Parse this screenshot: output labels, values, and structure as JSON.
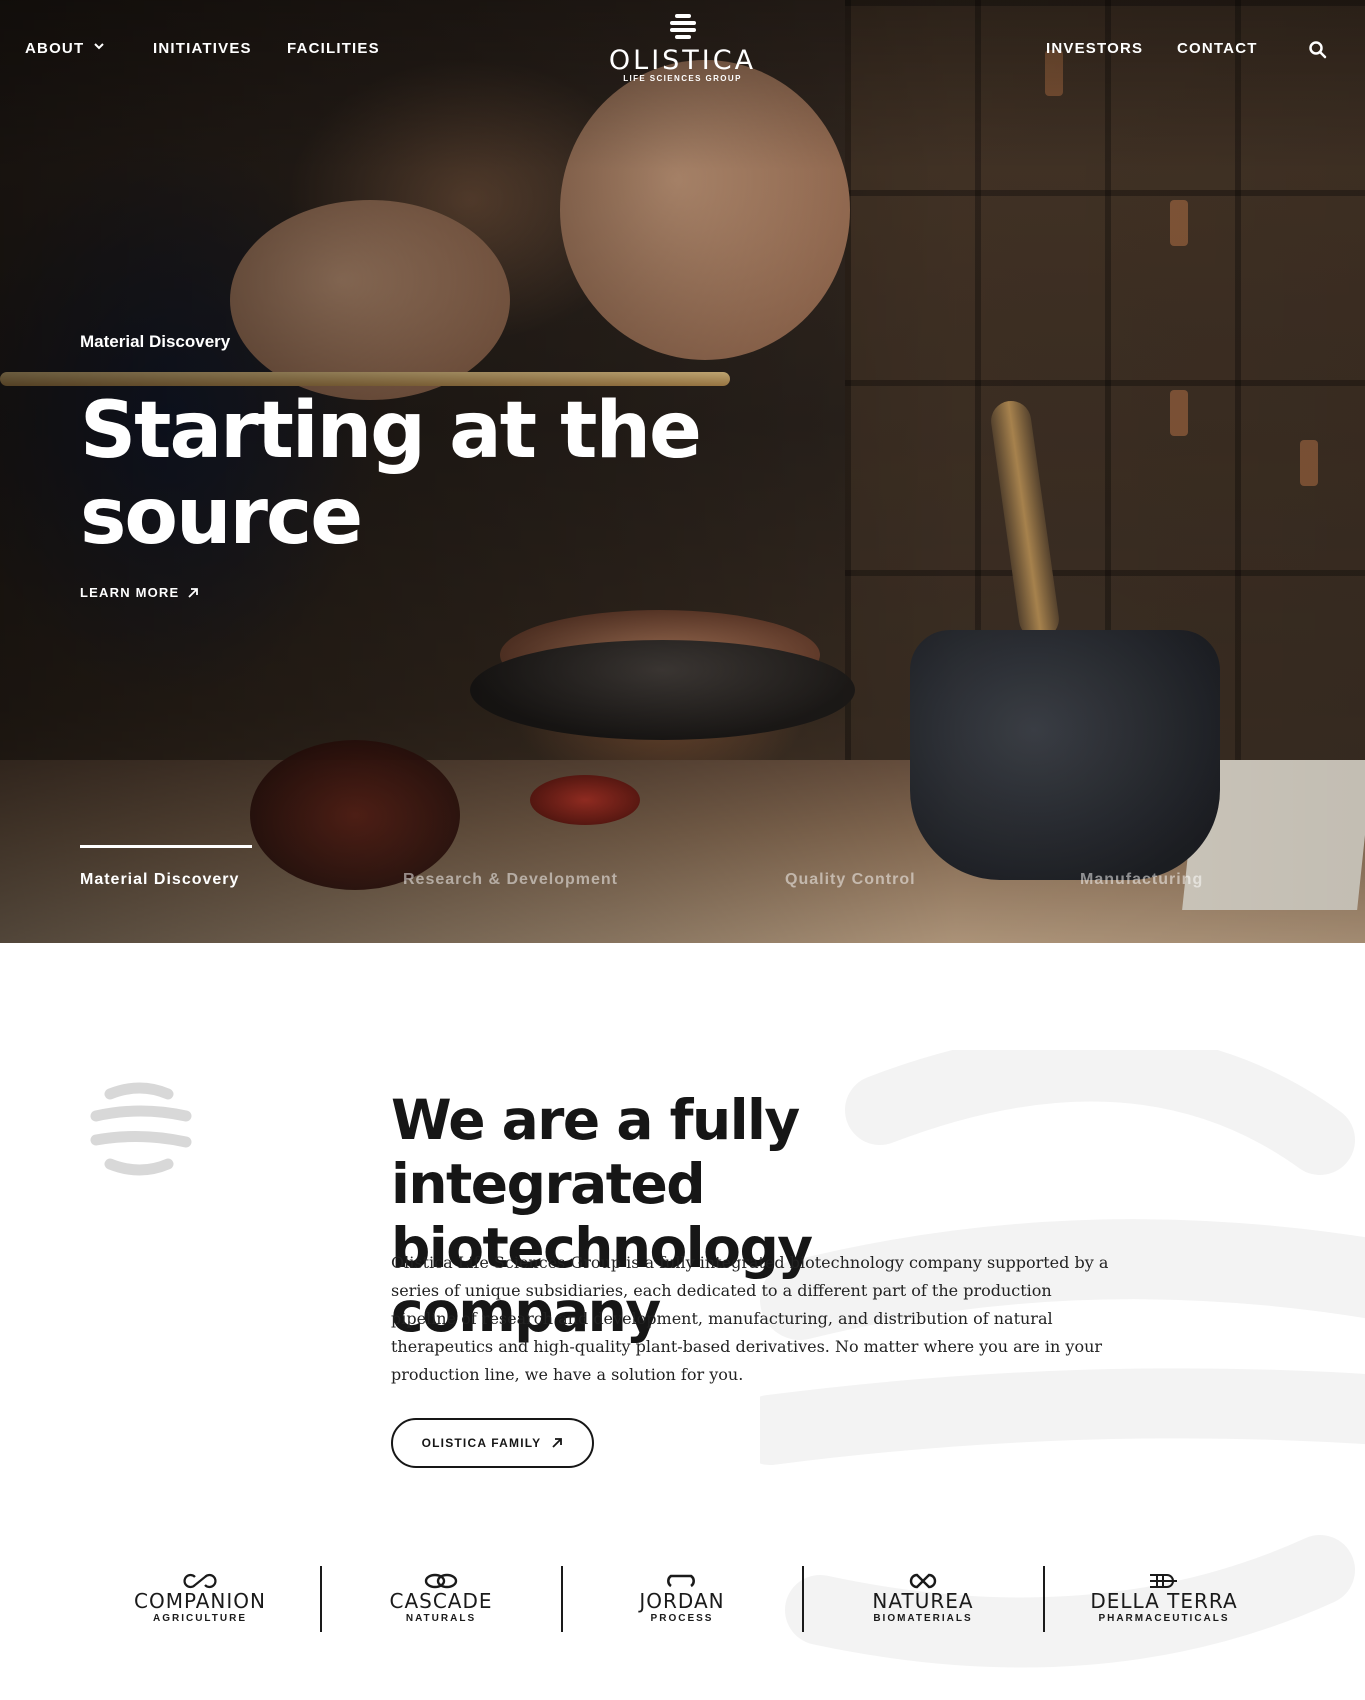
{
  "nav": {
    "about": "ABOUT",
    "initiatives": "INITIATIVES",
    "facilities": "FACILITIES",
    "investors": "INVESTORS",
    "contact": "CONTACT"
  },
  "logo": {
    "name": "OLISTICA",
    "tagline": "LIFE SCIENCES GROUP"
  },
  "hero": {
    "eyebrow": "Material Discovery",
    "title": "Starting at the source",
    "cta": "LEARN MORE",
    "tabs": [
      {
        "label": "Material Discovery",
        "active": true
      },
      {
        "label": "Research & Development",
        "active": false
      },
      {
        "label": "Quality Control",
        "active": false
      },
      {
        "label": "Manufacturing",
        "active": false
      }
    ]
  },
  "about": {
    "title": "We are a fully integrated biotechnology company",
    "body": "Olistica Life Sciences Group is a fully integrated biotechnology company supported by a series of unique subsidiaries, each dedicated to a different part of the production pipeline of research and development, manufacturing, and distribution of natural therapeutics and high-quality plant-based derivatives. No matter where you are in your production line, we have a solution for you.",
    "button": "OLISTICA FAMILY"
  },
  "brands": [
    {
      "name": "COMPANION",
      "sub": "AGRICULTURE",
      "icon": "companion-logo-icon"
    },
    {
      "name": "CASCADE",
      "sub": "NATURALS",
      "icon": "cascade-logo-icon"
    },
    {
      "name": "JORDAN",
      "sub": "PROCESS",
      "icon": "jordan-logo-icon"
    },
    {
      "name": "NATUREA",
      "sub": "BIOMATERIALS",
      "icon": "naturea-logo-icon"
    },
    {
      "name": "DELLA TERRA",
      "sub": "PHARMACEUTICALS",
      "icon": "della-terra-logo-icon"
    }
  ],
  "colors": {
    "text_dark": "#161616",
    "hero_text": "#ffffff",
    "background": "#ffffff"
  }
}
